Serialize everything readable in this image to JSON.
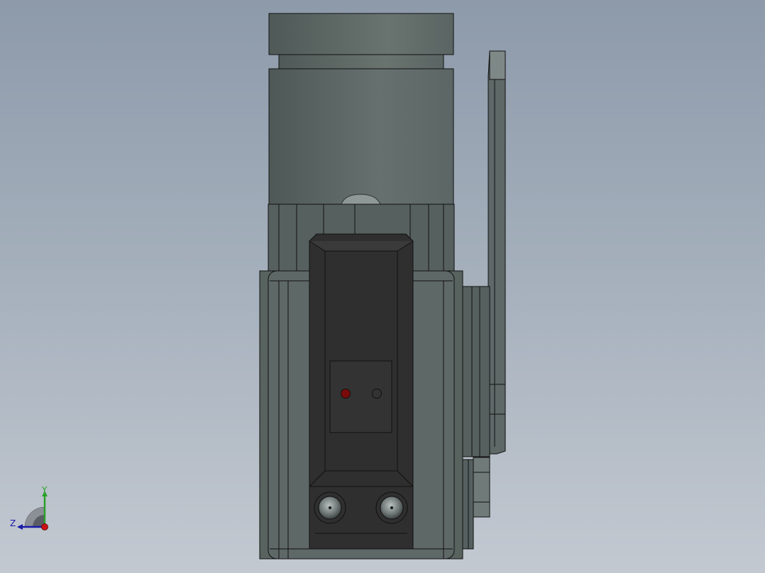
{
  "viewport": {
    "background_top": "#8d9aaa",
    "background_bottom": "#c3c9d1"
  },
  "model": {
    "body_color": "#5f6b6a",
    "dark_color": "#333333",
    "edge_color": "#111111",
    "led_red": "#7a0a0a"
  },
  "triad": {
    "y_label": "Y",
    "z_label": "Z",
    "y_color": "#2aa02a",
    "z_color": "#1a1aa8",
    "x_color": "#c81414"
  }
}
